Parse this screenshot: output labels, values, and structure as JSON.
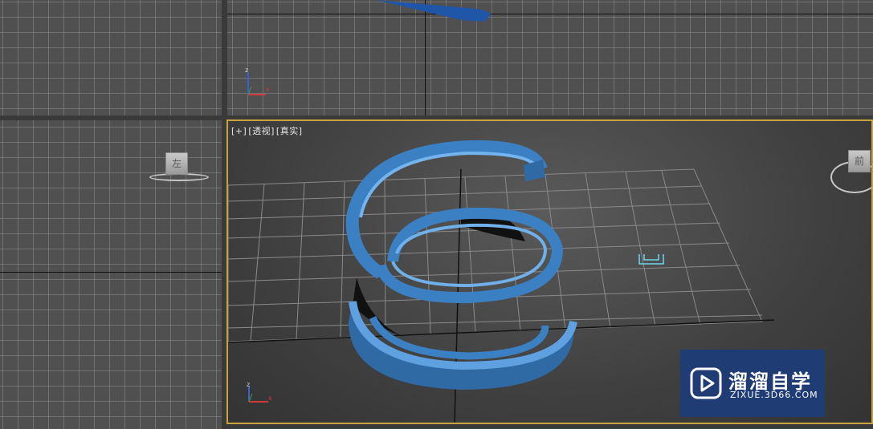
{
  "viewports": {
    "perspective": {
      "label_plus": "[+]",
      "label_view": "[透视]",
      "label_shading": "[真实]"
    },
    "left": {
      "cube_face": "左"
    },
    "perspective_cube": {
      "face": "前"
    }
  },
  "watermark": {
    "title": "溜溜自学",
    "url": "ZIXUE.3D66.COM"
  },
  "colors": {
    "object": "#3a7fc0",
    "active_border": "#c9a33b",
    "watermark_bg": "#1f3c75"
  }
}
